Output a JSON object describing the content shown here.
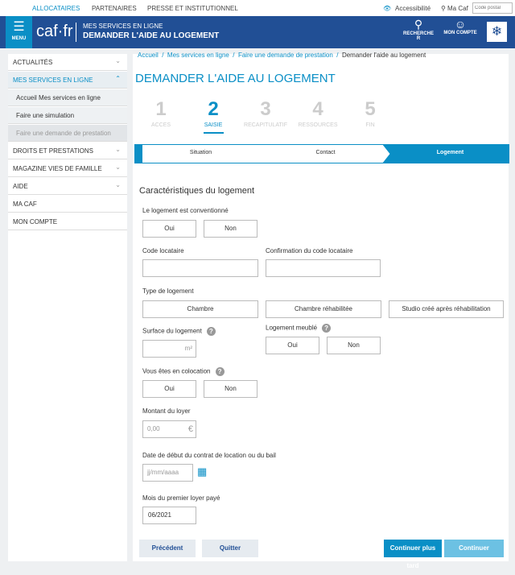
{
  "topnav": {
    "items": [
      "ALLOCATAIRES",
      "PARTENAIRES",
      "PRESSE ET INSTITUTIONNEL"
    ],
    "accessibility": "Accessibilité",
    "ma_caf": "Ma Caf",
    "postal_placeholder": "Code postal"
  },
  "header": {
    "menu": "MENU",
    "logo": "caf·fr",
    "subtitle": "MES SERVICES EN LIGNE",
    "title": "DEMANDER L'AIDE AU LOGEMENT",
    "search": "RECHERCHE R",
    "account": "MON COMPTE"
  },
  "sidebar": {
    "items": [
      {
        "label": "ACTUALITÉS"
      },
      {
        "label": "MES SERVICES EN LIGNE"
      },
      {
        "label": "Accueil Mes services en ligne"
      },
      {
        "label": "Faire une simulation"
      },
      {
        "label": "Faire une demande de prestation"
      },
      {
        "label": "DROITS ET PRESTATIONS"
      },
      {
        "label": "MAGAZINE VIES DE FAMILLE"
      },
      {
        "label": "AIDE"
      },
      {
        "label": "MA CAF"
      },
      {
        "label": "MON COMPTE"
      }
    ]
  },
  "breadcrumb": [
    "Accueil",
    "Mes services en ligne",
    "Faire une demande de prestation",
    "Demander l'aide au logement"
  ],
  "page_title": "DEMANDER L'AIDE AU LOGEMENT",
  "steps": [
    {
      "n": "1",
      "label": "ACCES"
    },
    {
      "n": "2",
      "label": "SAISIE"
    },
    {
      "n": "3",
      "label": "RECAPITULATIF"
    },
    {
      "n": "4",
      "label": "RESSOURCES"
    },
    {
      "n": "5",
      "label": "FIN"
    }
  ],
  "substeps": [
    "Situation",
    "Contact",
    "Logement"
  ],
  "form": {
    "section": "Caractéristiques du logement",
    "conventionne": "Le logement est conventionné",
    "oui": "Oui",
    "non": "Non",
    "code_locataire": "Code locataire",
    "confirm_code": "Confirmation du code locataire",
    "type": "Type de logement",
    "types": [
      "Chambre",
      "Chambre réhabilitée",
      "Studio créé après réhabilitation"
    ],
    "surface": "Surface du logement",
    "unit": "m²",
    "meuble": "Logement meublé",
    "colocation": "Vous êtes en colocation",
    "loyer": "Montant du loyer",
    "loyer_placeholder": "0,00",
    "currency": "€",
    "date_debut": "Date de début du contrat de location ou du bail",
    "date_placeholder": "jj/mm/aaaa",
    "mois": "Mois du premier loyer payé",
    "mois_value": "06/2021"
  },
  "buttons": {
    "prev": "Précédent",
    "quit": "Quitter",
    "later": "Continuer plus tard",
    "next": "Continuer"
  }
}
